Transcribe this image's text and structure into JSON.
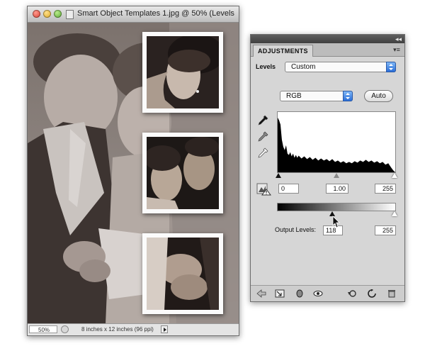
{
  "document": {
    "title": "Smart Object Templates 1.jpg @ 50% (Levels",
    "zoom": "50%",
    "status": "8 inches x 12 inches (96 ppi)"
  },
  "panel": {
    "tab": "ADJUSTMENTS",
    "collapse": "◂◂",
    "menu": "▾≡",
    "preset_label": "Levels",
    "preset_value": "Custom",
    "channel_value": "RGB",
    "auto_label": "Auto",
    "input_black": "0",
    "input_gamma": "1.00",
    "input_white": "255",
    "output_label": "Output Levels:",
    "output_black": "118",
    "output_white": "255",
    "output_black_fraction": 0.4627
  },
  "colors": {
    "selection_blue": "#2a6ed8",
    "panel_gray": "#d6d6d6"
  }
}
